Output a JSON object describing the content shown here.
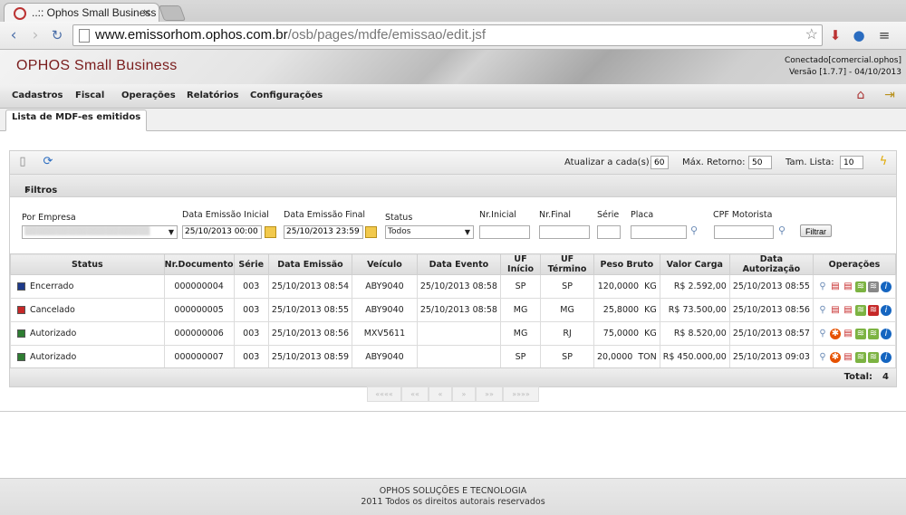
{
  "browser": {
    "tab_title": "..:: Ophos Small Business",
    "url_host": "www.emissorhom.ophos.com.br",
    "url_path": "/osb/pages/mdfe/emissao/edit.jsf"
  },
  "header": {
    "logo": "OPHOS Small Business",
    "connected": "Conectado[comercial.ophos]",
    "version": "Versão [1.7.7] - 04/10/2013"
  },
  "menu": [
    "Cadastros",
    "Fiscal",
    "Operações",
    "Relatórios",
    "Configurações"
  ],
  "subtab": "Lista de MDF-es emitidos",
  "toolbar": {
    "refresh_label": "Atualizar a cada(s):",
    "refresh_value": "60",
    "max_label": "Máx. Retorno:",
    "max_value": "50",
    "size_label": "Tam. Lista:",
    "size_value": "10"
  },
  "filters": {
    "title": "Filtros",
    "empresa_label": "Por Empresa",
    "data_ini_label": "Data Emissão Inicial",
    "data_ini_value": "25/10/2013 00:00",
    "data_fim_label": "Data Emissão Final",
    "data_fim_value": "25/10/2013 23:59",
    "status_label": "Status",
    "status_value": "Todos",
    "nr_ini_label": "Nr.Inicial",
    "nr_fim_label": "Nr.Final",
    "serie_label": "Série",
    "placa_label": "Placa",
    "cpf_label": "CPF Motorista",
    "filter_button": "Filtrar"
  },
  "table": {
    "headers": [
      "Status",
      "Nr.Documento",
      "Série",
      "Data Emissão",
      "Veículo",
      "Data Evento",
      "UF Início",
      "UF Término",
      "Peso Bruto",
      "Valor Carga",
      "Data Autorização",
      "Operações"
    ],
    "rows": [
      {
        "status": "Encerrado",
        "status_color": "#1e3a8a",
        "doc": "000000004",
        "serie": "003",
        "emissao": "25/10/2013 08:54",
        "veiculo": "ABY9040",
        "evento": "25/10/2013 08:58",
        "uf_ini": "SP",
        "uf_fim": "SP",
        "peso": "120,0000",
        "unid": "KG",
        "valor": "R$ 2.592,00",
        "autorizacao": "25/10/2013 08:55"
      },
      {
        "status": "Cancelado",
        "status_color": "#c62828",
        "doc": "000000005",
        "serie": "003",
        "emissao": "25/10/2013 08:55",
        "veiculo": "ABY9040",
        "evento": "25/10/2013 08:58",
        "uf_ini": "MG",
        "uf_fim": "MG",
        "peso": "25,8000",
        "unid": "KG",
        "valor": "R$ 73.500,00",
        "autorizacao": "25/10/2013 08:56"
      },
      {
        "status": "Autorizado",
        "status_color": "#2e7d32",
        "doc": "000000006",
        "serie": "003",
        "emissao": "25/10/2013 08:56",
        "veiculo": "MXV5611",
        "evento": "",
        "uf_ini": "MG",
        "uf_fim": "RJ",
        "peso": "75,0000",
        "unid": "KG",
        "valor": "R$ 8.520,00",
        "autorizacao": "25/10/2013 08:57"
      },
      {
        "status": "Autorizado",
        "status_color": "#2e7d32",
        "doc": "000000007",
        "serie": "003",
        "emissao": "25/10/2013 08:59",
        "veiculo": "ABY9040",
        "evento": "",
        "uf_ini": "SP",
        "uf_fim": "SP",
        "peso": "20,0000",
        "unid": "TON",
        "valor": "R$ 450.000,00",
        "autorizacao": "25/10/2013 09:03"
      }
    ],
    "total_label": "Total:",
    "total_value": "4"
  },
  "pager": [
    "««««",
    "««",
    "«",
    "»",
    "»»",
    "»»»»"
  ],
  "footer": {
    "line1": "OPHOS SOLUÇÕES E TECNOLOGIA",
    "line2": "2011 Todos os direitos autorais reservados"
  }
}
